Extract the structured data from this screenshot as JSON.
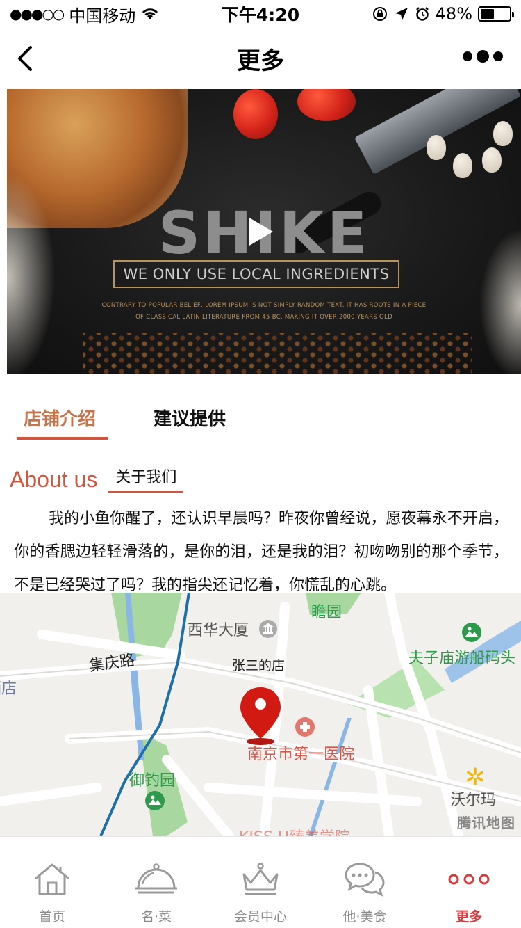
{
  "status_bar": {
    "carrier": "中国移动",
    "time": "下午4:20",
    "battery": "48%",
    "battery_level": 0.48
  },
  "nav": {
    "title": "更多"
  },
  "video": {
    "brand": "SHIKE",
    "tagline": "WE ONLY USE LOCAL INGREDIENTS",
    "small_line1": "CONTRARY TO POPULAR BELIEF, LOREM IPSUM IS NOT SIMPLY RANDOM TEXT. IT HAS ROOTS IN A PIECE",
    "small_line2": "OF CLASSICAL LATIN LITERATURE FROM 45 BC, MAKING IT OVER 2000 YEARS OLD"
  },
  "tabs": {
    "active": "店铺介绍",
    "inactive": "建议提供"
  },
  "about": {
    "title_en": "About us",
    "title_cn": "关于我们",
    "body": "我的小鱼你醒了，还认识早晨吗？昨夜你曾经说，愿夜幕永不开启，你的香腮边轻轻滑落的，是你的泪，还是我的泪？初吻吻别的那个季节，不是已经哭过了吗？我的指尖还记忆着，你慌乱的心跳。"
  },
  "map": {
    "labels": {
      "xihua": "西华大厦",
      "zhanyuan": "瞻园",
      "fuzimiao": "夫子庙游船码头",
      "jiqing": "集庆路",
      "shop": "张三的店",
      "hotel": "酒店",
      "hospital": "南京市第一医院",
      "yudiao": "御钓园",
      "walmart": "沃尔玛",
      "kiss": "KISS U臻美学院"
    },
    "watermark": "腾讯地图"
  },
  "tab_bar": [
    {
      "label": "首页",
      "icon": "home-icon"
    },
    {
      "label": "名·菜",
      "icon": "cloche-icon"
    },
    {
      "label": "会员中心",
      "icon": "crown-icon"
    },
    {
      "label": "他·美食",
      "icon": "chat-bubbles-icon"
    },
    {
      "label": "更多",
      "icon": "more-dots-icon"
    }
  ],
  "colors": {
    "accent": "#d4553e",
    "active_tab": "#d93b3b",
    "tab_text": "#c8744b"
  }
}
